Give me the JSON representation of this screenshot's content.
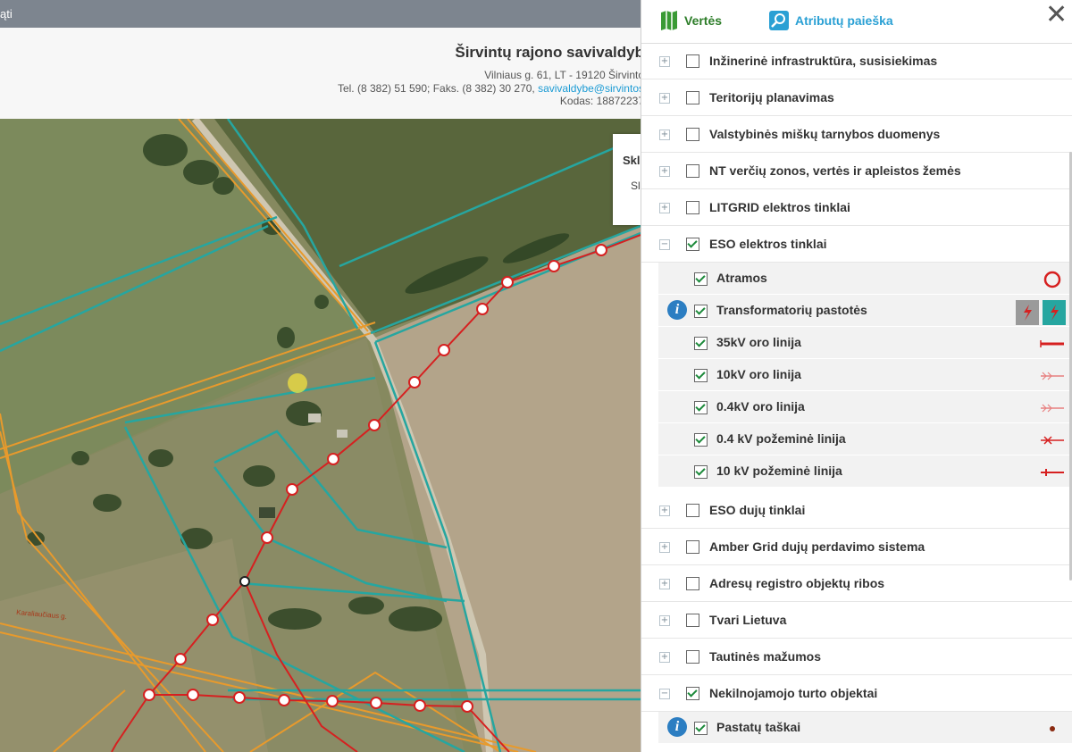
{
  "topbar": {
    "text": "ąti"
  },
  "header": {
    "title": "Širvintų rajono savivaldyb",
    "address": "Vilniaus g. 61, LT - 19120 Širvinto",
    "phone_prefix": "Tel. (8 382) 51 590; Faks. (8 382) 30 270, ",
    "email": "savivaldybe@sirvintos",
    "code": "Kodas: 18872237"
  },
  "popup": {
    "heading": "Skl",
    "sub": "Sl"
  },
  "map": {
    "street_label": "Karaliaučiaus g."
  },
  "tabs": {
    "values": "Vertės",
    "attr_search": "Atributų paieška"
  },
  "layers": [
    {
      "label": "Inžinerinė infrastruktūra, susisiekimas",
      "expanded": false,
      "checked": false
    },
    {
      "label": "Teritorijų planavimas",
      "expanded": false,
      "checked": false
    },
    {
      "label": "Valstybinės miškų tarnybos duomenys",
      "expanded": false,
      "checked": false
    },
    {
      "label": "NT verčių zonos, vertės ir apleistos žemės",
      "expanded": false,
      "checked": false
    },
    {
      "label": "LITGRID elektros tinklai",
      "expanded": false,
      "checked": false
    },
    {
      "label": "ESO elektros tinklai",
      "expanded": true,
      "checked": true
    },
    {
      "label": "ESO dujų tinklai",
      "expanded": false,
      "checked": false
    },
    {
      "label": "Amber Grid dujų perdavimo sistema",
      "expanded": false,
      "checked": false
    },
    {
      "label": "Adresų registro objektų ribos",
      "expanded": false,
      "checked": false
    },
    {
      "label": "Tvari Lietuva",
      "expanded": false,
      "checked": false
    },
    {
      "label": "Tautinės mažumos",
      "expanded": false,
      "checked": false
    },
    {
      "label": "Nekilnojamojo turto objektai",
      "expanded": true,
      "checked": true
    }
  ],
  "eso_sublayers": [
    {
      "label": "Atramos",
      "symbol": "circle-symbol-icon",
      "info": false
    },
    {
      "label": "Transformatorių pastotės",
      "symbol": "substation-symbol-icon",
      "info": true
    },
    {
      "label": "35kV oro linija",
      "symbol": "line-35kv-symbol-icon",
      "info": false
    },
    {
      "label": "10kV oro linija",
      "symbol": "line-10kv-symbol-icon",
      "info": false
    },
    {
      "label": "0.4kV oro linija",
      "symbol": "line-04kv-symbol-icon",
      "info": false
    },
    {
      "label": "0.4 kV požeminė linija",
      "symbol": "underground-04kv-symbol-icon",
      "info": false
    },
    {
      "label": "10 kV požeminė linija",
      "symbol": "underground-10kv-symbol-icon",
      "info": false
    }
  ],
  "nt_sublayers": [
    {
      "label": "Pastatų taškai",
      "symbol": "building-point-symbol-icon",
      "info": true
    }
  ],
  "colors": {
    "accent_green": "#2d7d29",
    "accent_blue": "#2aa0d4",
    "line_red": "#d62020",
    "parcel_teal": "#26a6a0",
    "parcel_orange": "#e89a2c"
  }
}
